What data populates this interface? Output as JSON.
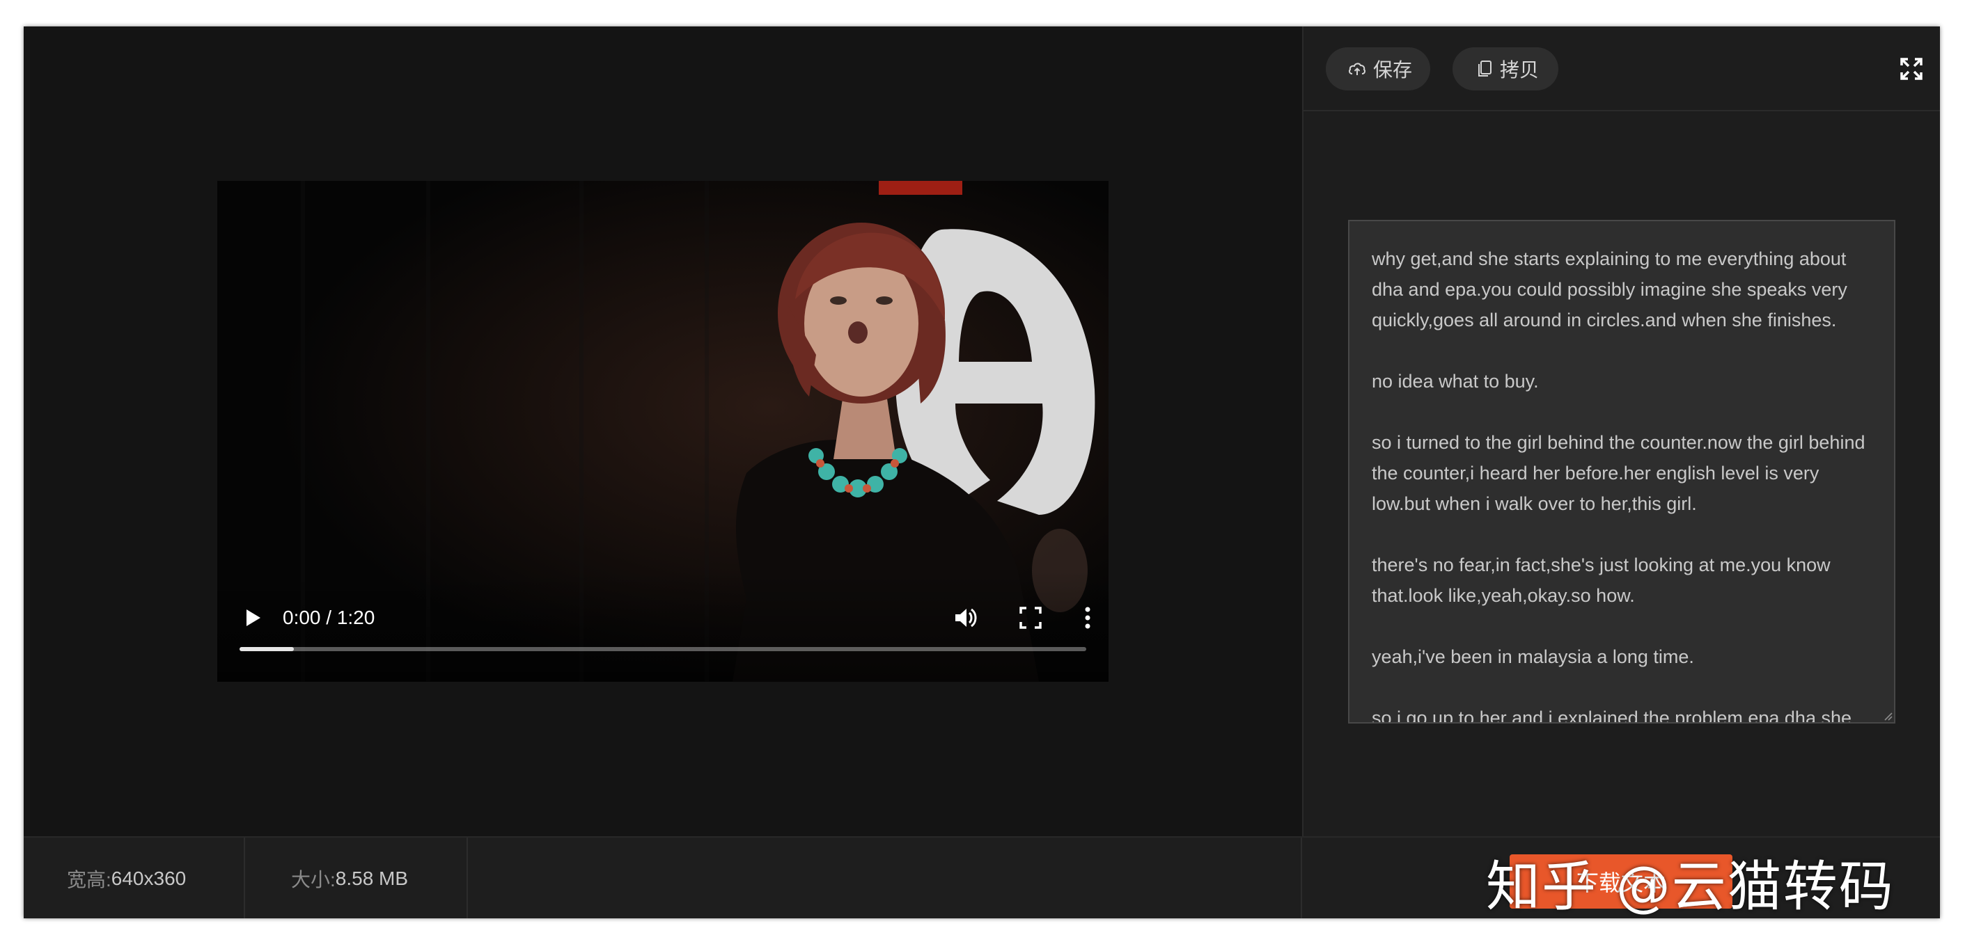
{
  "video": {
    "time": "0:00 / 1:20",
    "buffered_fraction": 0.064
  },
  "footer": {
    "dimensions_label": "宽高:",
    "dimensions_value": "640x360",
    "size_label": "大小:",
    "size_value": "8.58 MB",
    "download_label": "下载文本"
  },
  "toolbar": {
    "save_label": "保存",
    "copy_label": "拷贝"
  },
  "transcript": {
    "paragraphs": [
      "why get,and she starts explaining to me everything about dha and epa.you could possibly imagine she speaks very quickly,goes all around in circles.and when she finishes.",
      "no idea what to buy.",
      "so i turned to the girl behind the counter.now the girl behind the counter,i heard her before.her english level is very low.but when i walk over to her,this girl.",
      "there's no fear,in fact,she's just looking at me.you know that.look like,yeah,okay.so how.",
      "yeah,i've been in malaysia a long time.",
      "so i go up to her and i explained the problem.epa.dha.she"
    ]
  },
  "watermark": "知乎 @云猫转码",
  "colors": {
    "accent": "#e8572a",
    "background": "#141414",
    "panel": "#1d1d1d"
  }
}
